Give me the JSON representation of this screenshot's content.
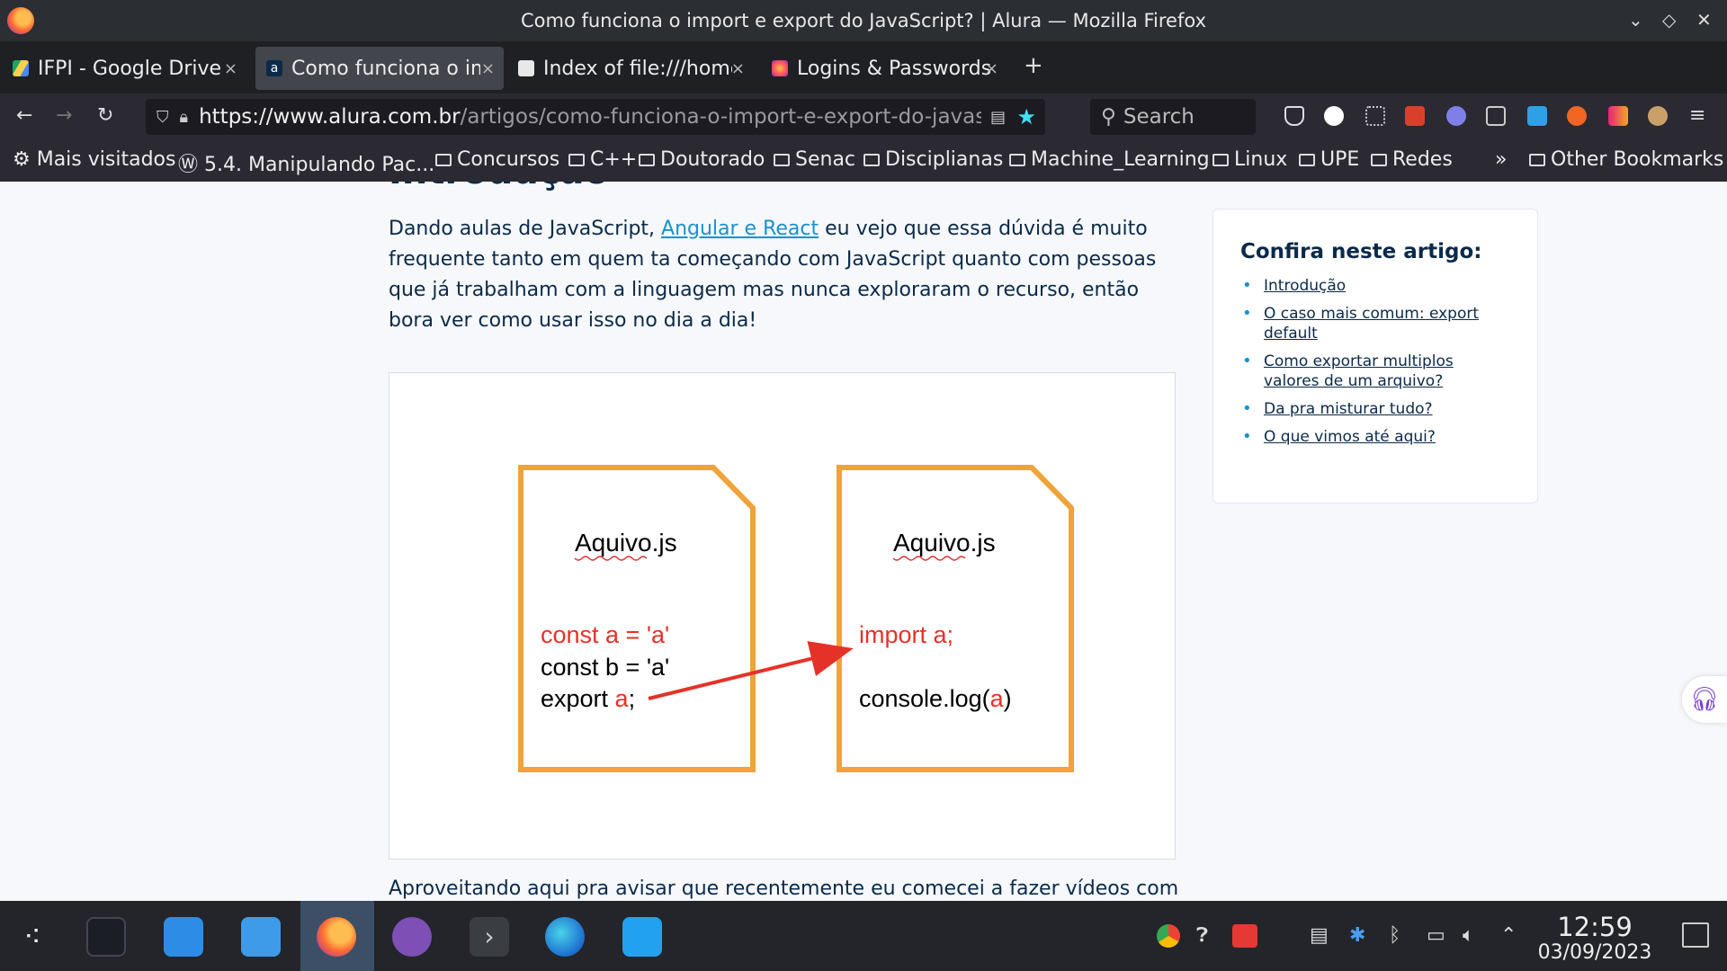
{
  "window": {
    "title": "Como funciona o import e export do JavaScript? | Alura — Mozilla Firefox"
  },
  "tabs": [
    {
      "label": "IFPI - Google Drive",
      "active": false
    },
    {
      "label": "Como funciona o import e export do JavaScript? | Alura",
      "active": true
    },
    {
      "label": "Index of file:///home/",
      "active": false
    },
    {
      "label": "Logins & Passwords",
      "active": false
    }
  ],
  "navbar": {
    "url_host": "https://www.alura.com.br",
    "url_path": "/artigos/como-funciona-o-import-e-export-do-javascript",
    "search_placeholder": "Search"
  },
  "bookmarks": [
    {
      "label": "Mais visitados",
      "icon": "gear-icon"
    },
    {
      "label": "5.4. Manipulando Pac...",
      "icon": "wordpress-icon"
    },
    {
      "label": "Concursos",
      "icon": "folder-icon"
    },
    {
      "label": "C++",
      "icon": "folder-icon"
    },
    {
      "label": "Doutorado",
      "icon": "folder-icon"
    },
    {
      "label": "Senac",
      "icon": "folder-icon"
    },
    {
      "label": "Disciplianas",
      "icon": "folder-icon"
    },
    {
      "label": "Machine_Learning",
      "icon": "folder-icon"
    },
    {
      "label": "Linux",
      "icon": "folder-icon"
    },
    {
      "label": "UPE",
      "icon": "folder-icon"
    },
    {
      "label": "Redes",
      "icon": "folder-icon"
    }
  ],
  "other_bookmarks": "Other Bookmarks",
  "article": {
    "heading_partial": "Introdução",
    "para_before": "Dando aulas de JavaScript, ",
    "para_link": "Angular e React",
    "para_after": " eu vejo que essa dúvida é muito frequente tanto em quem ta começando com JavaScript quanto com pessoas que já trabalham com a linguagem mas nunca exploraram o recurso, então bora ver como usar isso no dia a dia!",
    "bottom_text": "Aproveitando aqui pra avisar que recentemente eu comecei a fazer vídeos com",
    "figure": {
      "left_file": {
        "name": "Aquivo.js",
        "line1": "const a = 'a'",
        "line2": "const b = 'a'",
        "line3_prefix": "export ",
        "line3_var": "a",
        "line3_suffix": ";"
      },
      "right_file": {
        "name": "Aquivo.js",
        "line1": "import a;",
        "line2_prefix": "console.log(",
        "line2_var": "a",
        "line2_suffix": ")"
      },
      "colors": {
        "border": "#f0a33a",
        "highlight": "#e53228",
        "arrow": "#e53228"
      }
    }
  },
  "toc": {
    "title": "Confira neste artigo:",
    "items": [
      "Introdução",
      "O caso mais comum: export default",
      "Como exportar multiplos valores de um arquivo?",
      "Da pra misturar tudo?",
      "O que vimos até aqui?"
    ]
  },
  "taskbar": {
    "time": "12:59",
    "date": "03/09/2023"
  }
}
